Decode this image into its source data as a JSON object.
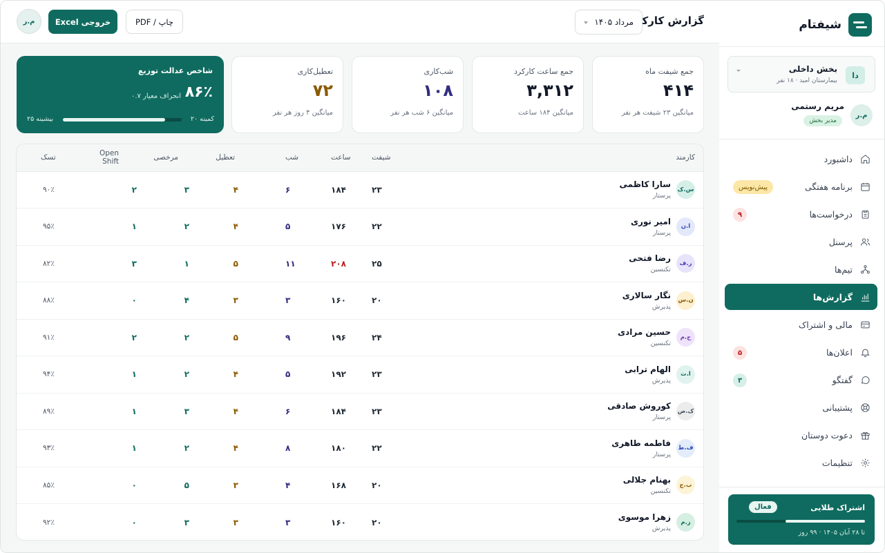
{
  "app": {
    "name": "شیفتام"
  },
  "org": {
    "avatar": "دا",
    "name": "بخش داخلی",
    "sub": "بیمارستان امید · ۱۸ نفر"
  },
  "user": {
    "avatar": "م.ر",
    "name": "مریم رستمی",
    "role": "مدیر بخش"
  },
  "nav": [
    {
      "label": "داشبورد",
      "icon": "home-icon"
    },
    {
      "label": "برنامه هفتگی",
      "icon": "calendar-icon",
      "badge": "پیش‌نویس"
    },
    {
      "label": "درخواست‌ها",
      "icon": "clipboard-icon",
      "badge": "۹"
    },
    {
      "label": "پرسنل",
      "icon": "users-icon"
    },
    {
      "label": "تیم‌ها",
      "icon": "teams-icon"
    },
    {
      "label": "گزارش‌ها",
      "icon": "bar-chart-icon",
      "active": true
    },
    {
      "label": "مالی و اشتراک",
      "icon": "credit-card-icon"
    },
    {
      "label": "اعلان‌ها",
      "icon": "bell-icon",
      "badge": "۵"
    },
    {
      "label": "گفتگو",
      "icon": "chat-icon",
      "badge": "۳"
    },
    {
      "label": "پشتیبانی",
      "icon": "lifebuoy-icon"
    },
    {
      "label": "دعوت دوستان",
      "icon": "gift-icon"
    },
    {
      "label": "تنظیمات",
      "icon": "gear-icon"
    }
  ],
  "subscription": {
    "title": "اشتراک طلایی",
    "status": "فعال",
    "progress": 0.62,
    "expiry": "تا ۲۸ آبان ۱۴۰۵ · ۹۹ روز"
  },
  "topbar": {
    "title": "گزارش کارکرد",
    "month": "مرداد ۱۴۰۵",
    "print_label": "چاپ / PDF",
    "excel_label": "خروجی Excel",
    "avatar": "م.ر"
  },
  "kpis": [
    {
      "label": "جمع شیفت ماه",
      "value": "۴۱۴",
      "sub": "میانگین ۲۳ شیفت هر نفر",
      "color": "#111827"
    },
    {
      "label": "جمع ساعت کارکرد",
      "value": "۳,۳۱۲",
      "sub": "میانگین ۱۸۴ ساعت",
      "color": "#111827"
    },
    {
      "label": "شب‌کاری",
      "value": "۱۰۸",
      "sub": "میانگین ۶ شب هر نفر",
      "color": "#312e81"
    },
    {
      "label": "تعطیل‌کاری",
      "value": "۷۲",
      "sub": "میانگین ۴ روز هر نفر",
      "color": "#8a5a00"
    }
  ],
  "fairness": {
    "title": "شاخص عدالت توزیع",
    "value": "۸۶٪",
    "deviation": "انحراف معیار ۰.۷",
    "min": "کمینه ۲۰",
    "max": "بیشینه ۲۵",
    "level": 0.86
  },
  "table": {
    "headers": {
      "employee": "کارمند",
      "shifts": "شیفت",
      "hours": "ساعت",
      "nights": "شب",
      "holidays": "تعطیل",
      "leave": "مرخصی",
      "open": "Open Shift",
      "task": "تسک"
    },
    "rows": [
      {
        "initials": "س.ک",
        "avatar_bg": "#d5efe8",
        "avatar_fg": "#0f6b5f",
        "name": "سارا کاظمی",
        "role": "پرستار",
        "shifts": "۲۳",
        "hours": "۱۸۴",
        "nights": "۶",
        "holidays": "۴",
        "leave": "۳",
        "open": "۲",
        "task": "۹۰٪"
      },
      {
        "initials": "ا.ن",
        "avatar_bg": "#e3e8fb",
        "avatar_fg": "#3b4bb8",
        "name": "امیر نوری",
        "role": "پرستار",
        "shifts": "۲۲",
        "hours": "۱۷۶",
        "nights": "۵",
        "holidays": "۴",
        "leave": "۲",
        "open": "۱",
        "task": "۹۵٪"
      },
      {
        "initials": "ر.ف",
        "avatar_bg": "#e6e3fb",
        "avatar_fg": "#4b3bb8",
        "name": "رضا فتحی",
        "role": "تکنسین",
        "shifts": "۲۵",
        "hours": "۲۰۸",
        "hours_over": true,
        "nights": "۱۱",
        "holidays": "۵",
        "leave": "۱",
        "open": "۳",
        "task": "۸۲٪"
      },
      {
        "initials": "ن.س",
        "avatar_bg": "#fdf0cf",
        "avatar_fg": "#8a5a00",
        "name": "نگار سالاری",
        "role": "پذیرش",
        "shifts": "۲۰",
        "hours": "۱۶۰",
        "nights": "۳",
        "holidays": "۳",
        "leave": "۴",
        "open": "۰",
        "task": "۸۸٪"
      },
      {
        "initials": "ح.م",
        "avatar_bg": "#efe3fb",
        "avatar_fg": "#6b3bb8",
        "name": "حسین مرادی",
        "role": "تکنسین",
        "shifts": "۲۴",
        "hours": "۱۹۶",
        "nights": "۹",
        "holidays": "۵",
        "leave": "۲",
        "open": "۲",
        "task": "۹۱٪"
      },
      {
        "initials": "ا.ت",
        "avatar_bg": "#e0f3ee",
        "avatar_fg": "#0f6b5f",
        "name": "الهام ترابی",
        "role": "پذیرش",
        "shifts": "۲۳",
        "hours": "۱۹۲",
        "nights": "۵",
        "holidays": "۴",
        "leave": "۲",
        "open": "۱",
        "task": "۹۴٪"
      },
      {
        "initials": "ک.ص",
        "avatar_bg": "#ececec",
        "avatar_fg": "#4b5563",
        "name": "کوروش صادقی",
        "role": "پرستار",
        "shifts": "۲۳",
        "hours": "۱۸۴",
        "nights": "۶",
        "holidays": "۴",
        "leave": "۳",
        "open": "۱",
        "task": "۸۹٪"
      },
      {
        "initials": "ف.ط",
        "avatar_bg": "#e3ecfb",
        "avatar_fg": "#2b4bb8",
        "name": "فاطمه طاهری",
        "role": "پرستار",
        "shifts": "۲۲",
        "hours": "۱۸۰",
        "nights": "۸",
        "holidays": "۴",
        "leave": "۲",
        "open": "۱",
        "task": "۹۳٪"
      },
      {
        "initials": "ب.ج",
        "avatar_bg": "#fdf3d6",
        "avatar_fg": "#8a5a00",
        "name": "بهنام جلالی",
        "role": "تکنسین",
        "shifts": "۲۰",
        "hours": "۱۶۸",
        "nights": "۴",
        "holidays": "۳",
        "leave": "۵",
        "open": "۰",
        "task": "۸۵٪"
      },
      {
        "initials": "ز.م",
        "avatar_bg": "#d5efe3",
        "avatar_fg": "#0f6b5f",
        "name": "زهرا موسوی",
        "role": "پذیرش",
        "shifts": "۲۰",
        "hours": "۱۶۰",
        "nights": "۳",
        "holidays": "۳",
        "leave": "۳",
        "open": "۰",
        "task": "۹۲٪"
      }
    ]
  }
}
